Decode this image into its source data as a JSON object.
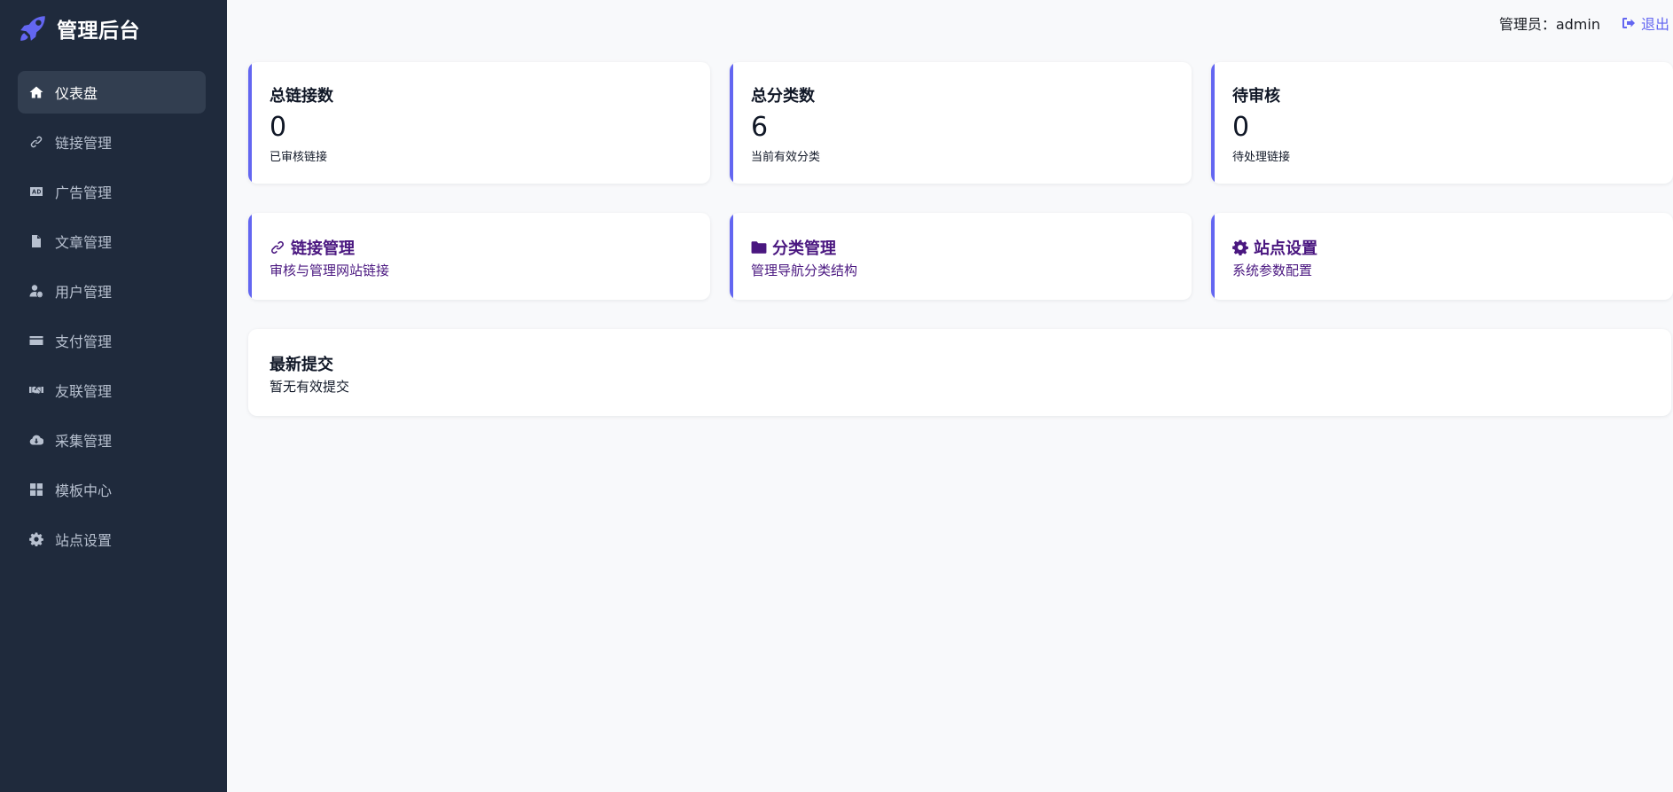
{
  "brand": {
    "title": "管理后台",
    "icon": "rocket-icon"
  },
  "sidebar": {
    "items": [
      {
        "label": "仪表盘",
        "icon": "home-icon",
        "active": true
      },
      {
        "label": "链接管理",
        "icon": "link-icon",
        "active": false
      },
      {
        "label": "广告管理",
        "icon": "ad-icon",
        "active": false
      },
      {
        "label": "文章管理",
        "icon": "file-icon",
        "active": false
      },
      {
        "label": "用户管理",
        "icon": "user-cog-icon",
        "active": false
      },
      {
        "label": "支付管理",
        "icon": "credit-card-icon",
        "active": false
      },
      {
        "label": "友联管理",
        "icon": "handshake-icon",
        "active": false
      },
      {
        "label": "采集管理",
        "icon": "cloud-download-icon",
        "active": false
      },
      {
        "label": "模板中心",
        "icon": "grid-icon",
        "active": false
      },
      {
        "label": "站点设置",
        "icon": "gear-icon",
        "active": false
      }
    ]
  },
  "header": {
    "admin_label": "管理员：admin",
    "logout_label": "退出",
    "logout_icon": "sign-out-icon"
  },
  "stats": [
    {
      "title": "总链接数",
      "value": "0",
      "desc": "已审核链接"
    },
    {
      "title": "总分类数",
      "value": "6",
      "desc": "当前有效分类"
    },
    {
      "title": "待审核",
      "value": "0",
      "desc": "待处理链接"
    }
  ],
  "quick_links": [
    {
      "title": "链接管理",
      "desc": "审核与管理网站链接",
      "icon": "link-icon"
    },
    {
      "title": "分类管理",
      "desc": "管理导航分类结构",
      "icon": "folder-icon"
    },
    {
      "title": "站点设置",
      "desc": "系统参数配置",
      "icon": "gear-icon"
    }
  ],
  "recent": {
    "title": "最新提交",
    "empty_text": "暂无有效提交"
  },
  "colors": {
    "sidebar_bg": "#1f2a3c",
    "sidebar_active": "#323e50",
    "accent": "#6366f1",
    "quick_link_text": "#4a1780",
    "page_bg": "#f8f9fb"
  }
}
